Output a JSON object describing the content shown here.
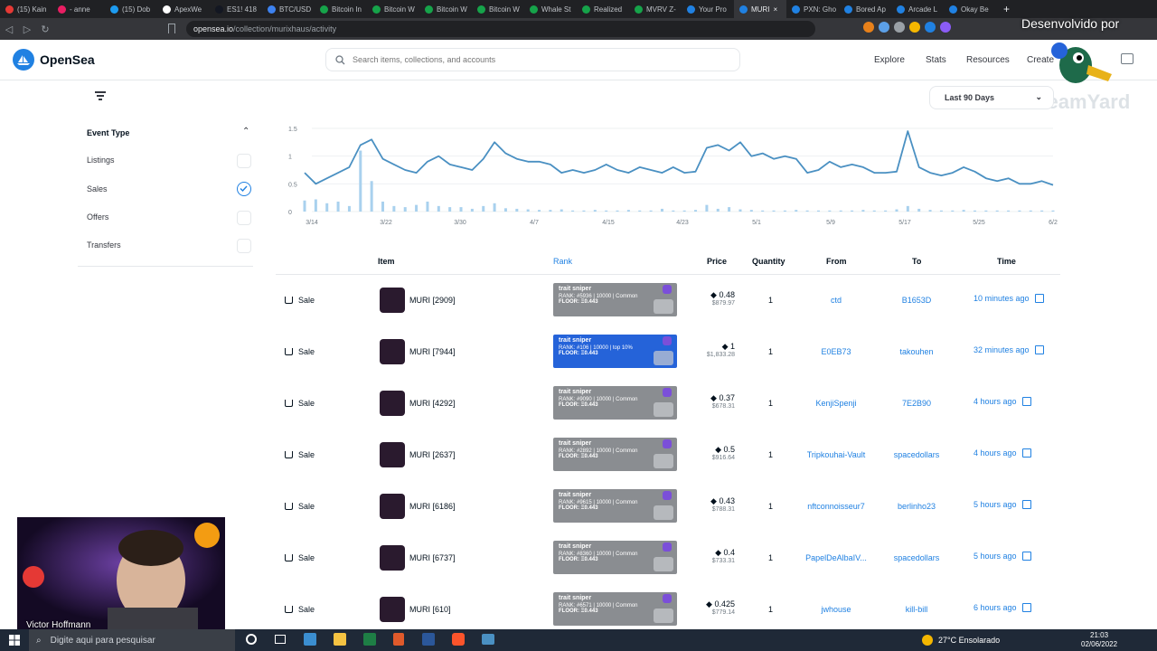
{
  "browser": {
    "tabs": [
      {
        "label": "(15) Kain",
        "color": "#e53935"
      },
      {
        "label": "- anne",
        "color": "#e91e63"
      },
      {
        "label": "(15) Dob",
        "color": "#1d9bf0"
      },
      {
        "label": "ApexWe",
        "color": "#ffffff"
      },
      {
        "label": "ES1! 418",
        "color": "#131722"
      },
      {
        "label": "BTC/USD",
        "color": "#3d82f0"
      },
      {
        "label": "Bitcoin In",
        "color": "#16a34a"
      },
      {
        "label": "Bitcoin W",
        "color": "#16a34a"
      },
      {
        "label": "Bitcoin W",
        "color": "#16a34a"
      },
      {
        "label": "Bitcoin W",
        "color": "#16a34a"
      },
      {
        "label": "Whale St",
        "color": "#16a34a"
      },
      {
        "label": "Realized",
        "color": "#16a34a"
      },
      {
        "label": "MVRV Z-",
        "color": "#16a34a"
      },
      {
        "label": "Your Pro",
        "color": "#2081e2"
      },
      {
        "label": "MURI",
        "color": "#2081e2",
        "active": true
      },
      {
        "label": "PXN: Gho",
        "color": "#2081e2"
      },
      {
        "label": "Bored Ap",
        "color": "#2081e2"
      },
      {
        "label": "Arcade L",
        "color": "#2081e2"
      },
      {
        "label": "Okay Be",
        "color": "#2081e2"
      }
    ],
    "url_host": "opensea.io",
    "url_path": "/collection/murixhaus/activity",
    "close_glyph": "×",
    "newtab_glyph": "+"
  },
  "header": {
    "logo_text": "OpenSea",
    "search_placeholder": "Search items, collections, and accounts",
    "nav": [
      "Explore",
      "Stats",
      "Resources",
      "Create"
    ]
  },
  "overlay": {
    "developed_by": "Desenvolvido por",
    "streamyard": "StreamYard"
  },
  "filters": {
    "date_range": "Last 90 Days",
    "event_type_title": "Event Type",
    "event_types": [
      {
        "label": "Listings",
        "checked": false
      },
      {
        "label": "Sales",
        "checked": true
      },
      {
        "label": "Offers",
        "checked": false
      },
      {
        "label": "Transfers",
        "checked": false
      }
    ]
  },
  "chart_data": {
    "type": "line",
    "x_ticks": [
      "3/14",
      "3/22",
      "3/30",
      "4/7",
      "4/15",
      "4/23",
      "5/1",
      "5/9",
      "5/17",
      "5/25",
      "6/2"
    ],
    "y_ticks": [
      "1.5",
      "1",
      "0.5",
      "0"
    ],
    "ylim": [
      0,
      1.5
    ],
    "series": [
      {
        "values": [
          0.7,
          0.5,
          0.6,
          0.7,
          0.8,
          1.2,
          1.3,
          0.95,
          0.85,
          0.75,
          0.7,
          0.9,
          1.0,
          0.85,
          0.8,
          0.75,
          0.95,
          1.25,
          1.05,
          0.95,
          0.9,
          0.9,
          0.85,
          0.7,
          0.75,
          0.7,
          0.75,
          0.85,
          0.75,
          0.7,
          0.8,
          0.75,
          0.7,
          0.8,
          0.7,
          0.72,
          1.15,
          1.2,
          1.1,
          1.25,
          1.0,
          1.05,
          0.95,
          1.0,
          0.95,
          0.7,
          0.75,
          0.9,
          0.8,
          0.85,
          0.8,
          0.7,
          0.7,
          0.72,
          1.45,
          0.8,
          0.7,
          0.65,
          0.7,
          0.8,
          0.72,
          0.6,
          0.55,
          0.6,
          0.5,
          0.5,
          0.55,
          0.48
        ]
      },
      {
        "type": "bar",
        "values": [
          0.2,
          0.22,
          0.15,
          0.18,
          0.1,
          1.1,
          0.55,
          0.18,
          0.1,
          0.08,
          0.12,
          0.18,
          0.1,
          0.08,
          0.08,
          0.05,
          0.1,
          0.15,
          0.06,
          0.05,
          0.04,
          0.03,
          0.03,
          0.04,
          0.02,
          0.02,
          0.03,
          0.02,
          0.02,
          0.03,
          0.02,
          0.02,
          0.05,
          0.02,
          0.02,
          0.03,
          0.12,
          0.05,
          0.08,
          0.04,
          0.03,
          0.02,
          0.02,
          0.02,
          0.03,
          0.02,
          0.02,
          0.02,
          0.02,
          0.02,
          0.03,
          0.02,
          0.02,
          0.04,
          0.1,
          0.05,
          0.03,
          0.02,
          0.02,
          0.03,
          0.02,
          0.02,
          0.02,
          0.02,
          0.02,
          0.02,
          0.02,
          0.02
        ]
      }
    ],
    "line_color": "#4a90c2",
    "bar_color": "#a9d1ee"
  },
  "table": {
    "headers": {
      "item": "Item",
      "rank": "Rank",
      "price": "Price",
      "quantity": "Quantity",
      "from": "From",
      "to": "To",
      "time": "Time"
    },
    "rank_title": "trait sniper",
    "floor_label": "FLOOR:",
    "floor_value": "Ξ0.443",
    "rows": [
      {
        "event": "Sale",
        "item": "MURI [2909]",
        "rank": "RANK: #5936 | 10000 | Common",
        "top": false,
        "price": "0.48",
        "usd": "$879.97",
        "qty": "1",
        "from": "ctd",
        "to": "B1653D",
        "time": "10 minutes ago"
      },
      {
        "event": "Sale",
        "item": "MURI [7944]",
        "rank": "RANK: #106 | 10000 | top 10%",
        "top": true,
        "price": "1",
        "usd": "$1,833.28",
        "qty": "1",
        "from": "E0EB73",
        "to": "takouhen",
        "time": "32 minutes ago"
      },
      {
        "event": "Sale",
        "item": "MURI [4292]",
        "rank": "RANK: #9090 | 10000 | Common",
        "top": false,
        "price": "0.37",
        "usd": "$678.31",
        "qty": "1",
        "from": "KenjiSpenji",
        "to": "7E2B90",
        "time": "4 hours ago"
      },
      {
        "event": "Sale",
        "item": "MURI [2637]",
        "rank": "RANK: #2892 | 10000 | Common",
        "top": false,
        "price": "0.5",
        "usd": "$916.64",
        "qty": "1",
        "from": "Tripkouhai-Vault",
        "to": "spacedollars",
        "time": "4 hours ago"
      },
      {
        "event": "Sale",
        "item": "MURI [6186]",
        "rank": "RANK: #9615 | 10000 | Common",
        "top": false,
        "price": "0.43",
        "usd": "$788.31",
        "qty": "1",
        "from": "nftconnoisseur7",
        "to": "berlinho23",
        "time": "5 hours ago"
      },
      {
        "event": "Sale",
        "item": "MURI [6737]",
        "rank": "RANK: #8360 | 10000 | Common",
        "top": false,
        "price": "0.4",
        "usd": "$733.31",
        "qty": "1",
        "from": "PapelDeAlbaIV...",
        "to": "spacedollars",
        "time": "5 hours ago"
      },
      {
        "event": "Sale",
        "item": "MURI [610]",
        "rank": "RANK: #6571 | 10000 | Common",
        "top": false,
        "price": "0.425",
        "usd": "$779.14",
        "qty": "1",
        "from": "jwhouse",
        "to": "kill-bill",
        "time": "6 hours ago"
      }
    ]
  },
  "webcam": {
    "name": "Victor Hoffmann"
  },
  "taskbar": {
    "search_placeholder": "Digite aqui para pesquisar",
    "weather": "27°C  Ensolarado",
    "time": "21:03",
    "date": "02/06/2022"
  }
}
